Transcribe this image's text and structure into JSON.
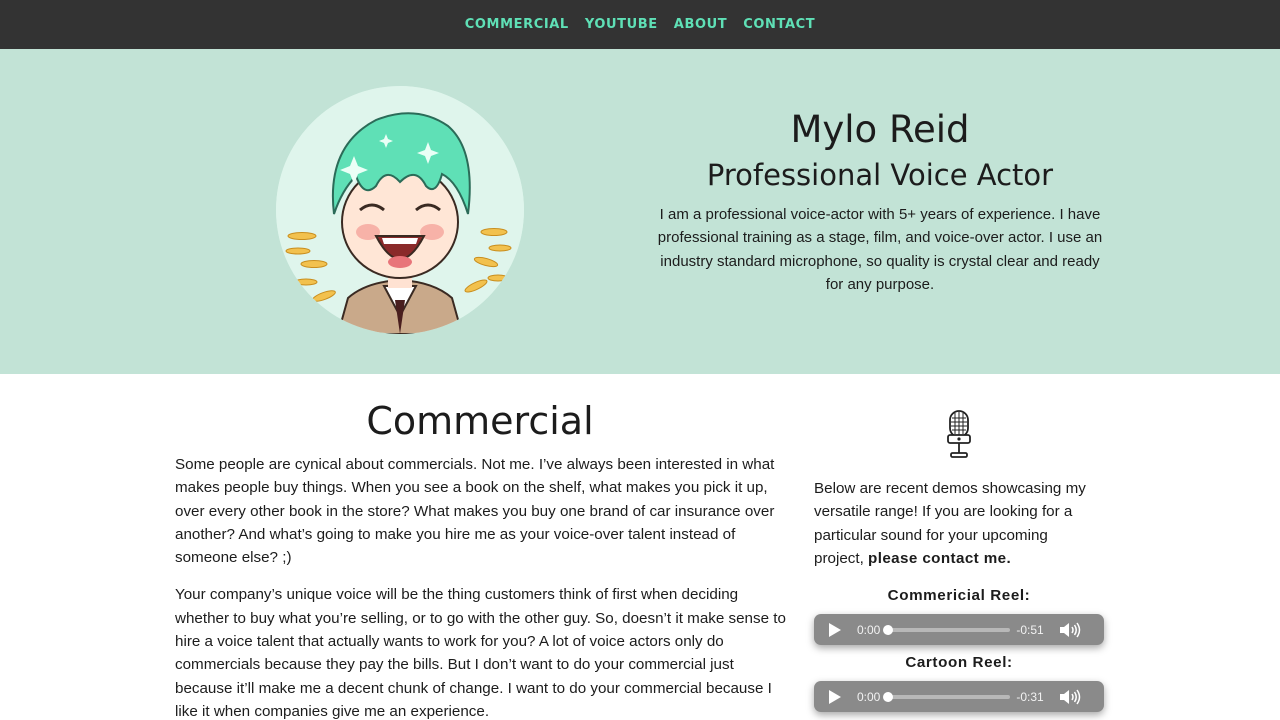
{
  "nav": {
    "items": [
      {
        "label": "COMMERCIAL"
      },
      {
        "label": "YOUTUBE"
      },
      {
        "label": "ABOUT"
      },
      {
        "label": "CONTACT"
      }
    ]
  },
  "hero": {
    "name": "Mylo Reid",
    "role": "Professional Voice Actor",
    "bio": "I am a professional voice-actor with 5+ years of experience. I have professional training as a stage, film, and voice-over actor. I use an industry standard microphone, so quality is crystal clear and ready for any purpose.",
    "avatar_icon": "cartoon-avatar"
  },
  "main": {
    "title": "Commercial",
    "paragraphs": [
      "Some people are cynical about commercials. Not me. I’ve always been interested in what makes people buy things. When you see a book on the shelf, what makes you pick it up, over every other book in the store? What makes you buy one brand of car insurance over another? And what’s going to make you hire me as your voice-over talent instead of someone else? ;)",
      "Your company’s unique voice will be the thing customers think of first when deciding whether to buy what you’re selling, or to go with the other guy. So, doesn’t it make sense to hire a voice talent that actually wants to work for you? A lot of voice actors only do commercials because they pay the bills. But I don’t want to do your commercial just because it’ll make me a decent chunk of change. I want to do your commercial because I like it when companies give me an experience."
    ]
  },
  "side": {
    "intro": "Below are recent demos showcasing my versatile range! If you are looking for a particular sound for your upcoming project, ",
    "contact_link": "please contact me.",
    "reels": [
      {
        "label": "Commericial Reel:",
        "current": "0:00",
        "remaining": "-0:51",
        "progress": 0
      },
      {
        "label": "Cartoon Reel:",
        "current": "0:00",
        "remaining": "-0:31",
        "progress": 0
      }
    ]
  },
  "colors": {
    "nav_bg": "#333333",
    "nav_link": "#5fe0b6",
    "hero_bg": "#c2e3d6",
    "player_bg": "#8a8a8a"
  }
}
